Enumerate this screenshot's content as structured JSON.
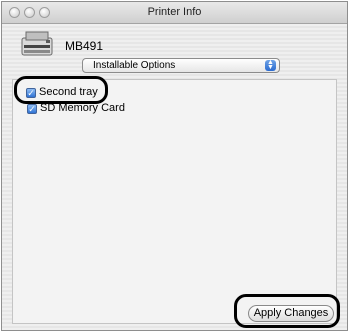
{
  "window": {
    "title": "Printer Info"
  },
  "printer": {
    "model": "MB491",
    "icon": "printer-icon"
  },
  "popup": {
    "selected": "Installable Options"
  },
  "options": [
    {
      "label": "Second tray",
      "checked": true
    },
    {
      "label": "SD Memory Card",
      "checked": true
    }
  ],
  "actions": {
    "apply_label": "Apply Changes"
  },
  "colors": {
    "accent": "#2f73d5",
    "highlight_outline": "#000000"
  }
}
